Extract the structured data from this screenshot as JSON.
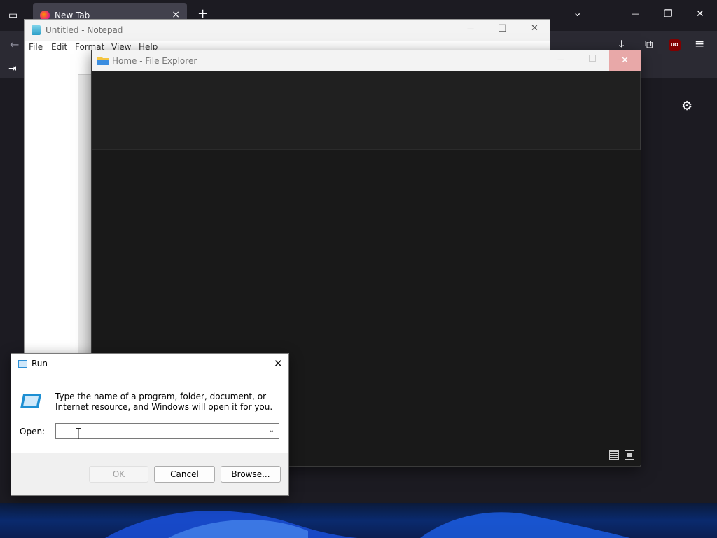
{
  "browser": {
    "tab_title": "New Tab",
    "tab_close": "×",
    "new_tab": "+",
    "list_all_tabs": "⌄",
    "minimize": "—",
    "restore": "❐",
    "close": "✕",
    "back": "←",
    "downloads": "⤓",
    "extensions": "⧉",
    "ublock_label": "uO",
    "menu": "≡",
    "sign_in": "⇥",
    "settings": "⚙"
  },
  "notepad": {
    "title": "Untitled - Notepad",
    "minimize": "—",
    "maximize": "☐",
    "close": "✕",
    "menu": [
      "File",
      "Edit",
      "Format",
      "View",
      "Help"
    ]
  },
  "explorer": {
    "title": "Home - File Explorer",
    "minimize": "—",
    "close": "✕"
  },
  "run_dialog": {
    "title": "Run",
    "close": "✕",
    "description": "Type the name of a program, folder, document, or Internet resource, and Windows will open it for you.",
    "open_label": "Open:",
    "input_value": "",
    "dropdown": "⌄",
    "ok_label": "OK",
    "cancel_label": "Cancel",
    "browse_label": "Browse..."
  }
}
